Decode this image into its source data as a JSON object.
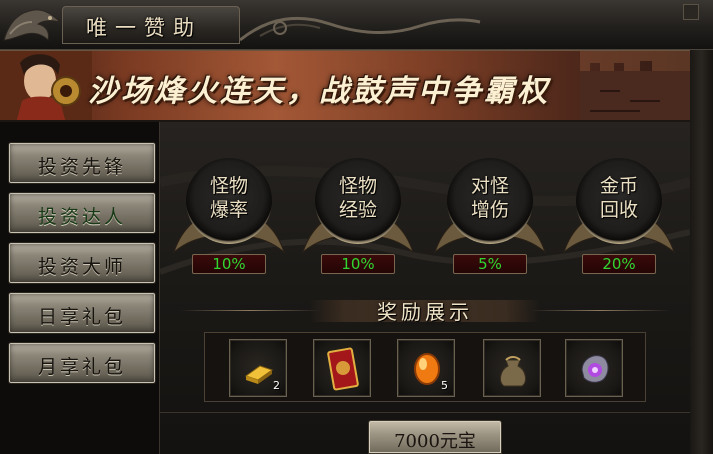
{
  "window": {
    "title": "唯一赞助"
  },
  "banner": {
    "slogan": "沙场烽火连天，战鼓声中争霸权"
  },
  "sidebar": {
    "active_index": 1,
    "items": [
      {
        "label": "投资先锋"
      },
      {
        "label": "投资达人"
      },
      {
        "label": "投资大师"
      },
      {
        "label": "日享礼包"
      },
      {
        "label": "月享礼包"
      }
    ]
  },
  "bonuses": [
    {
      "label": "怪物爆率",
      "line1": "怪物",
      "line2": "爆率",
      "value": "10%"
    },
    {
      "label": "怪物经验",
      "line1": "怪物",
      "line2": "经验",
      "value": "10%"
    },
    {
      "label": "对怪增伤",
      "line1": "对怪",
      "line2": "增伤",
      "value": "5%"
    },
    {
      "label": "金币回收",
      "line1": "金币",
      "line2": "回收",
      "value": "20%"
    }
  ],
  "rewards": {
    "title": "奖励展示",
    "items": [
      {
        "icon": "gold-bar-icon",
        "count": "2"
      },
      {
        "icon": "red-card-icon",
        "count": ""
      },
      {
        "icon": "orange-gem-icon",
        "count": "5"
      },
      {
        "icon": "pouch-icon",
        "count": ""
      },
      {
        "icon": "purple-stone-icon",
        "count": ""
      }
    ]
  },
  "purchase": {
    "price_label": "7000元宝"
  },
  "colors": {
    "percent_text": "#31d631",
    "title_text": "#e9dcc0",
    "button_face": "#8d877a"
  }
}
